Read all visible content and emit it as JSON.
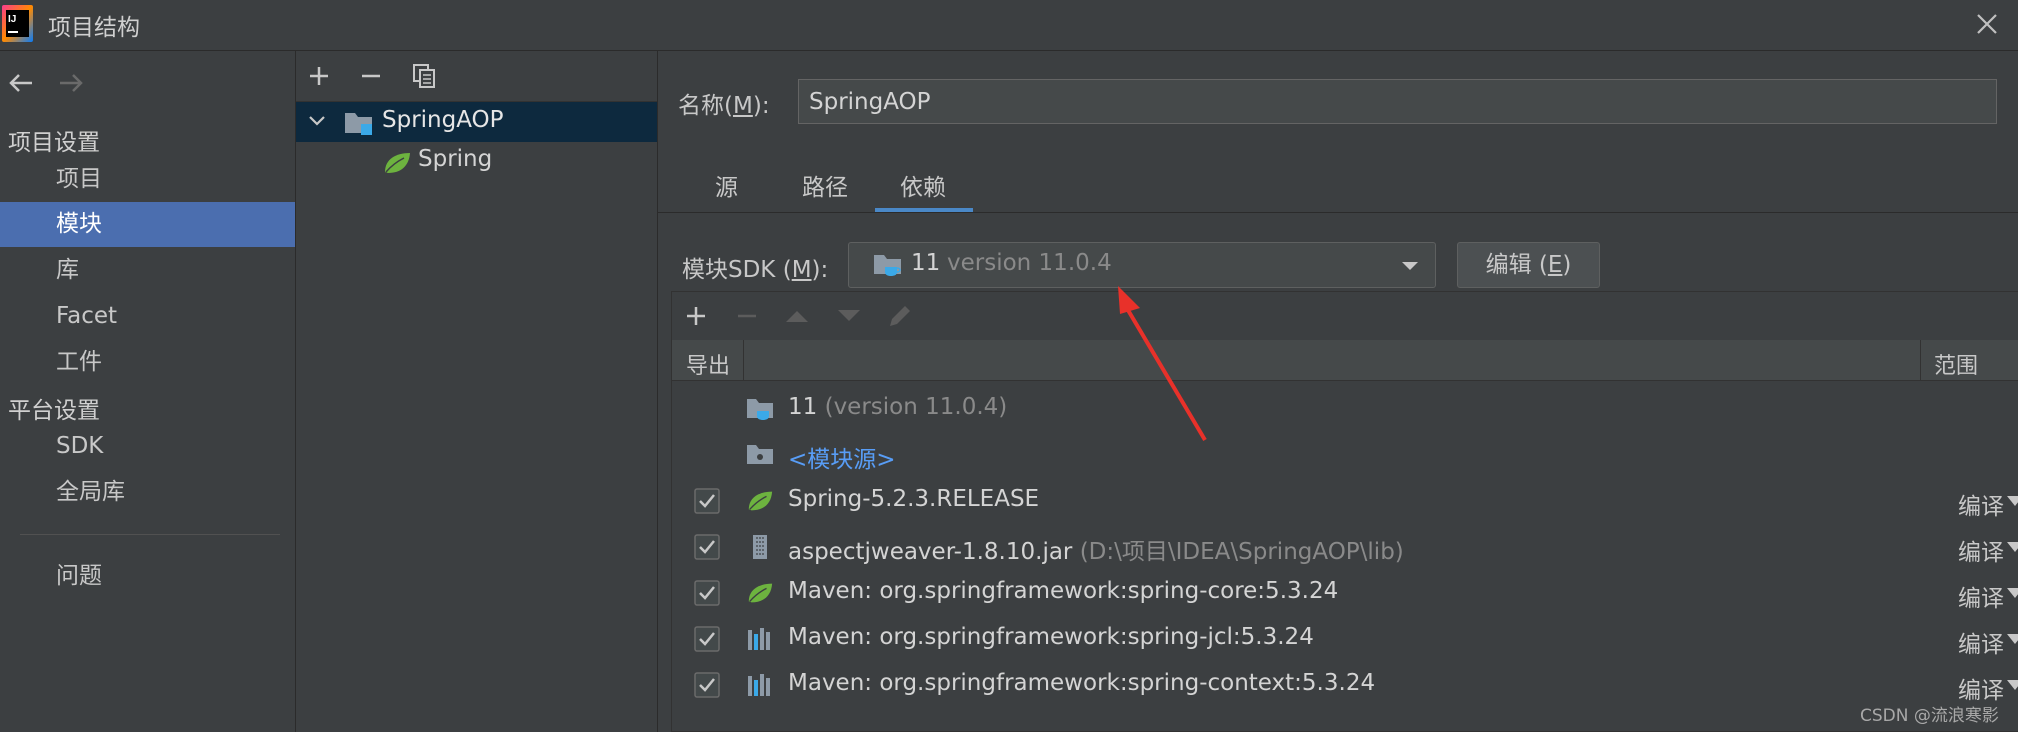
{
  "window": {
    "title": "项目结构",
    "app_icon": "intellij-idea-icon"
  },
  "nav": {
    "project_settings_header": "项目设置",
    "project_settings_items": [
      {
        "label": "项目",
        "selected": false
      },
      {
        "label": "模块",
        "selected": true
      },
      {
        "label": "库",
        "selected": false
      },
      {
        "label": "Facet",
        "selected": false
      },
      {
        "label": "工件",
        "selected": false
      }
    ],
    "platform_settings_header": "平台设置",
    "platform_settings_items": [
      {
        "label": "SDK"
      },
      {
        "label": "全局库"
      }
    ],
    "problems": "问题"
  },
  "module_tree": {
    "root": {
      "label": "SpringAOP",
      "expanded": true,
      "selected": true
    },
    "children": [
      {
        "label": "Spring",
        "icon": "spring-leaf-icon"
      }
    ]
  },
  "details": {
    "name_label": "名称(",
    "name_mnemonic": "M",
    "name_label_end": "):",
    "name_value": "SpringAOP",
    "tabs": [
      {
        "label": "源",
        "active": false
      },
      {
        "label": "路径",
        "active": false
      },
      {
        "label": "依赖",
        "active": true
      }
    ],
    "sdk_label": "模块SDK (",
    "sdk_mnemonic": "M",
    "sdk_label_end": "):",
    "sdk_value_main": "11",
    "sdk_value_version": "version 11.0.4",
    "edit_label": "编辑 (",
    "edit_mnemonic": "E",
    "edit_label_end": ")"
  },
  "dependencies": {
    "header_export": "导出",
    "header_scope": "范围",
    "rows": [
      {
        "name": "11",
        "detail": "(version 11.0.4)",
        "icon": "jdk-folder-icon",
        "checkbox": false,
        "scope": ""
      },
      {
        "name": "<模块源>",
        "detail": "",
        "icon": "module-source-folder-icon",
        "checkbox": false,
        "scope": "",
        "link": true
      },
      {
        "name": "Spring-5.2.3.RELEASE",
        "detail": "",
        "icon": "spring-leaf-icon",
        "checkbox": true,
        "checked": true,
        "scope": "编译"
      },
      {
        "name": "aspectjweaver-1.8.10.jar",
        "detail": "(D:\\项目\\IDEA\\SpringAOP\\lib)",
        "icon": "jar-file-icon",
        "checkbox": true,
        "checked": true,
        "scope": "编译"
      },
      {
        "name": "Maven: org.springframework:spring-core:5.3.24",
        "detail": "",
        "icon": "spring-leaf-icon",
        "checkbox": true,
        "checked": true,
        "scope": "编译"
      },
      {
        "name": "Maven: org.springframework:spring-jcl:5.3.24",
        "detail": "",
        "icon": "library-icon",
        "checkbox": true,
        "checked": true,
        "scope": "编译"
      },
      {
        "name": "Maven: org.springframework:spring-context:5.3.24",
        "detail": "",
        "icon": "library-icon",
        "checkbox": true,
        "checked": true,
        "scope": "编译"
      }
    ]
  },
  "watermark": "CSDN @流浪寒影",
  "colors": {
    "background": "#3c3f41",
    "selection": "#4b6eaf",
    "tree_selection": "#0d293e",
    "tab_underline": "#4a88c7",
    "link": "#589df6",
    "spring_green": "#6db33f",
    "arrow": "#e8312a"
  }
}
